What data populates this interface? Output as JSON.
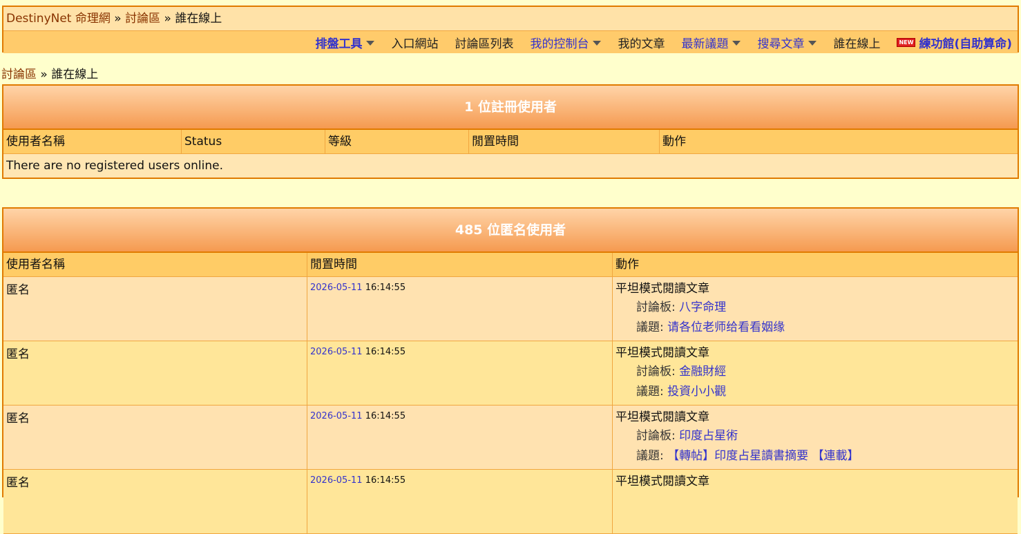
{
  "topbar": {
    "crumb_home": "DestinyNet 命理網",
    "crumb_sep1": " » ",
    "crumb_forum": "討論區",
    "crumb_sep2": " » ",
    "crumb_current": "誰在線上",
    "menu": [
      {
        "label": "排盤工具",
        "style": "bold",
        "caret": true
      },
      {
        "label": "入口網站",
        "style": "plain",
        "caret": false
      },
      {
        "label": "討論區列表",
        "style": "plain",
        "caret": false
      },
      {
        "label": "我的控制台",
        "style": "link",
        "caret": true
      },
      {
        "label": "我的文章",
        "style": "plain",
        "caret": false
      },
      {
        "label": "最新議題",
        "style": "link",
        "caret": true
      },
      {
        "label": "搜尋文章",
        "style": "link",
        "caret": true
      },
      {
        "label": "誰在線上",
        "style": "plain",
        "caret": false
      },
      {
        "label": "練功館(自助算命)",
        "style": "bold",
        "caret": false,
        "badge": "NEW"
      }
    ]
  },
  "navline": {
    "forum": "討論區",
    "sep": " » ",
    "current": "誰在線上"
  },
  "registered": {
    "heading": "1 位註冊使用者",
    "columns": [
      "使用者名稱",
      "Status",
      "等級",
      "閒置時間",
      "動作"
    ],
    "empty": "There are no registered users online."
  },
  "anonymous": {
    "heading": "485 位匿名使用者",
    "columns": [
      "使用者名稱",
      "閒置時間",
      "動作"
    ],
    "rows": [
      {
        "user": "匿名",
        "date": "2026-05-11",
        "time": "16:14:55",
        "action": "平坦模式閱讀文章",
        "board_label": "討論板: ",
        "board": "八字命理",
        "topic_label": "議題: ",
        "topic": "请各位老师给看看姻缘"
      },
      {
        "user": "匿名",
        "date": "2026-05-11",
        "time": "16:14:55",
        "action": "平坦模式閱讀文章",
        "board_label": "討論板: ",
        "board": "金融財經",
        "topic_label": "議題: ",
        "topic": "投資小小觀"
      },
      {
        "user": "匿名",
        "date": "2026-05-11",
        "time": "16:14:55",
        "action": "平坦模式閱讀文章",
        "board_label": "討論板: ",
        "board": "印度占星術",
        "topic_label": "議題: ",
        "topic": "【轉帖】印度占星讀書摘要 【連載】"
      },
      {
        "user": "匿名",
        "date": "2026-05-11",
        "time": "16:14:55",
        "action": "平坦模式閱讀文章",
        "board_label": "",
        "board": "",
        "topic_label": "",
        "topic": ""
      }
    ]
  }
}
